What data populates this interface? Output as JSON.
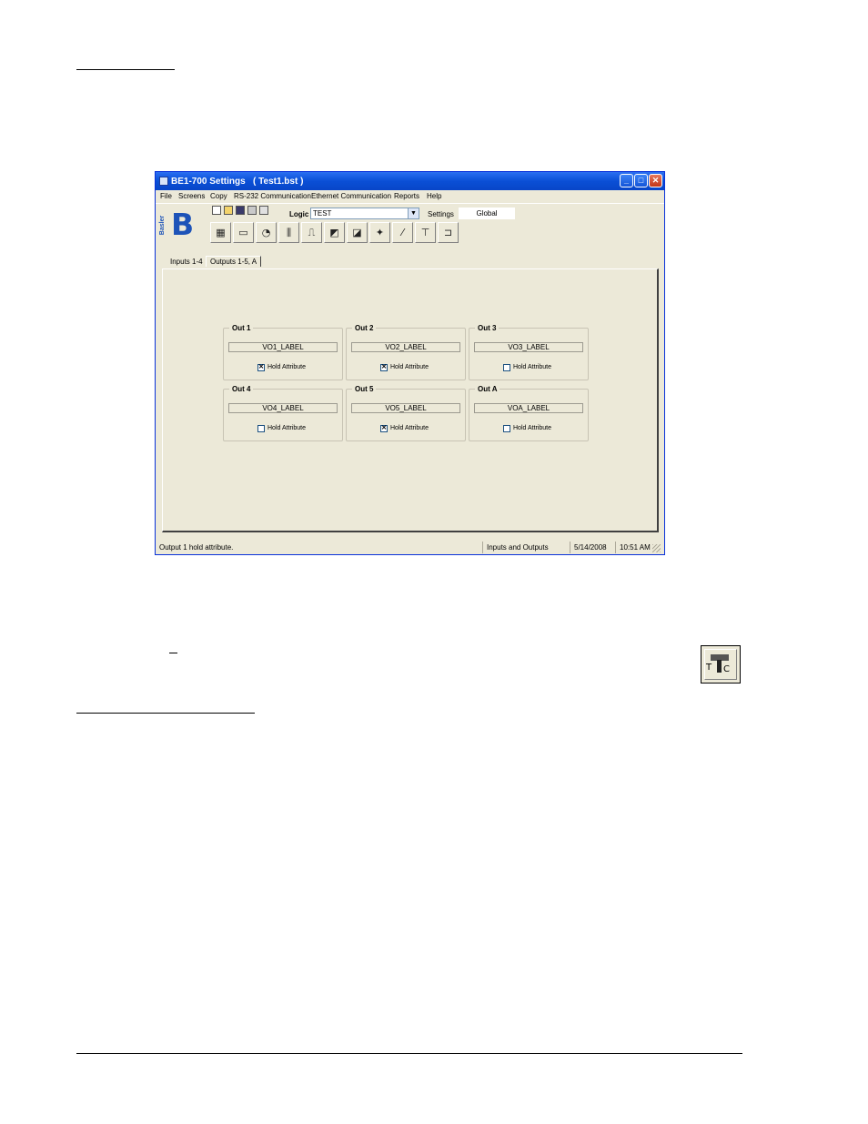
{
  "window": {
    "title": "BE1-700 Settings   ( Test1.bst )",
    "controls": {
      "minimize": "_",
      "maximize": "□",
      "close": "✕"
    }
  },
  "menu": [
    "File",
    "Screens",
    "Copy",
    "RS-232 Communication",
    "Ethernet Communication",
    "Reports",
    "Help"
  ],
  "toolbar": {
    "logic_label": "Logic",
    "logic_value": "TEST",
    "settings_label": "Settings",
    "settings_value": "Global",
    "logo_letter": "B",
    "logo_word": "Basler"
  },
  "tabs": [
    "Inputs 1-4",
    "Outputs 1-5, A"
  ],
  "outputs": [
    {
      "title": "Out 1",
      "label": "VO1_LABEL",
      "hold_text": "Hold Attribute",
      "checked": true
    },
    {
      "title": "Out 2",
      "label": "VO2_LABEL",
      "hold_text": "Hold Attribute",
      "checked": true
    },
    {
      "title": "Out 3",
      "label": "VO3_LABEL",
      "hold_text": "Hold Attribute",
      "checked": false
    },
    {
      "title": "Out 4",
      "label": "VO4_LABEL",
      "hold_text": "Hold Attribute",
      "checked": false
    },
    {
      "title": "Out 5",
      "label": "VO5_LABEL",
      "hold_text": "Hold Attribute",
      "checked": true
    },
    {
      "title": "Out A",
      "label": "VOA_LABEL",
      "hold_text": "Hold Attribute",
      "checked": false
    }
  ],
  "statusbar": {
    "message": "Output 1 hold attribute.",
    "screen": "Inputs and Outputs",
    "date": "5/14/2008",
    "time": "10:51 AM"
  },
  "side_icon": {
    "t": "T",
    "c": "C",
    "name": "tc-icon"
  }
}
